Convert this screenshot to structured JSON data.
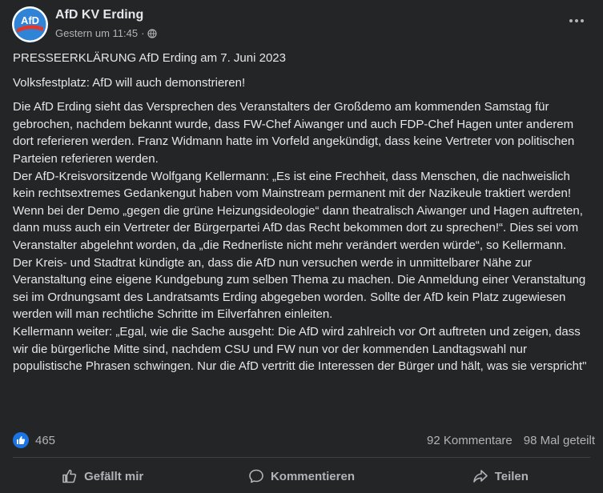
{
  "post": {
    "page_name": "AfD KV Erding",
    "timestamp": "Gestern um 11:45",
    "separator": "·",
    "avatar_text": "AfD",
    "paragraphs": [
      "PRESSEERKLÄRUNG AfD Erding am 7. Juni 2023",
      "Volksfestplatz: AfD will auch demonstrieren!",
      "Die AfD Erding sieht das Versprechen des Veranstalters der Großdemo am kommenden Samstag für gebrochen, nachdem bekannt wurde, dass FW-Chef Aiwanger und auch FDP-Chef Hagen unter anderem dort referieren werden. Franz Widmann hatte im Vorfeld angekündigt, dass keine Vertreter von politischen Parteien referieren werden.",
      "Der AfD-Kreisvorsitzende Wolfgang Kellermann: „Es ist eine Frechheit, dass Menschen, die nachweislich kein rechtsextremes Gedankengut haben vom Mainstream permanent mit der Nazikeule traktiert werden! Wenn bei der Demo „gegen die grüne Heizungsideologie“ dann theatralisch Aiwanger und Hagen auftreten, dann muss auch ein Vertreter der Bürgerpartei AfD das Recht bekommen dort zu sprechen!“. Dies sei vom Veranstalter abgelehnt worden, da „die Rednerliste nicht mehr verändert werden würde“, so Kellermann.",
      "Der Kreis- und Stadtrat kündigte an, dass die AfD nun versuchen werde in unmittelbarer Nähe zur Veranstaltung eine eigene Kundgebung zum selben Thema zu machen. Die Anmeldung einer Veranstaltung sei im Ordnungsamt des Landratsamts Erding abgegeben worden. Sollte der AfD kein Platz zugewiesen werden will man rechtliche Schritte im Eilverfahren einleiten.",
      "Kellermann weiter: „Egal, wie die Sache ausgeht: Die AfD wird zahlreich vor Ort auftreten und zeigen, dass wir die bürgerliche Mitte sind, nachdem CSU und FW nun vor der kommenden Landtagswahl nur populistische Phrasen schwingen. Nur die AfD vertritt die Interessen der Bürger und hält, was sie verspricht\""
    ]
  },
  "stats": {
    "likes": "465",
    "comments": "92 Kommentare",
    "shares": "98 Mal geteilt"
  },
  "actions": {
    "like": "Gefällt mir",
    "comment": "Kommentieren",
    "share": "Teilen"
  },
  "colors": {
    "background": "#242526",
    "text": "#e4e6eb",
    "secondary": "#b0b3b8",
    "accent": "#1b74e4"
  },
  "icons": [
    "globe-icon",
    "more-icon",
    "like-icon",
    "comment-icon",
    "share-icon"
  ]
}
